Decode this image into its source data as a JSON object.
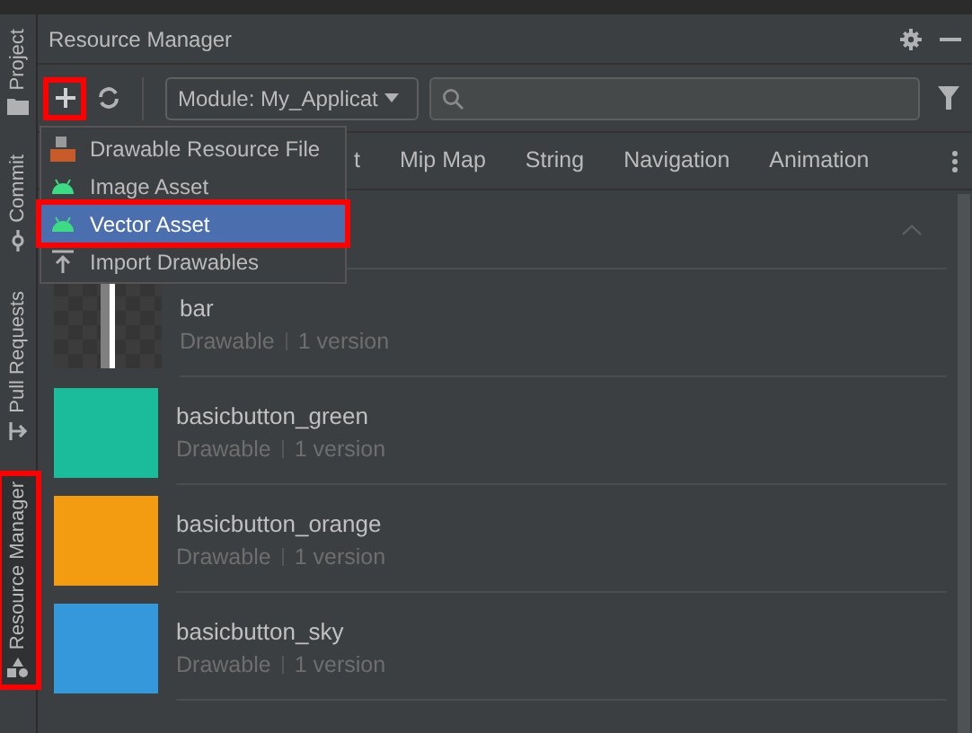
{
  "side_tabs": [
    {
      "label": "Project",
      "kind": "folder",
      "selected": false,
      "highlighted": false
    },
    {
      "label": "Commit",
      "kind": "commit",
      "selected": false,
      "highlighted": false
    },
    {
      "label": "Pull Requests",
      "kind": "pull",
      "selected": false,
      "highlighted": false
    },
    {
      "label": "Resource Manager",
      "kind": "shapes",
      "selected": true,
      "highlighted": true
    }
  ],
  "panel": {
    "title": "Resource Manager"
  },
  "toolbar": {
    "add_highlighted": true,
    "module": "Module: My_Applicat"
  },
  "tabs": [
    "t",
    "Mip Map",
    "String",
    "Navigation",
    "Animation"
  ],
  "menu": [
    {
      "label": "Drawable Resource File",
      "kind": "file",
      "selected": false,
      "highlighted": false
    },
    {
      "label": "Image Asset",
      "kind": "android",
      "selected": false,
      "highlighted": false
    },
    {
      "label": "Vector Asset",
      "kind": "android",
      "selected": true,
      "highlighted": true
    },
    {
      "label": "Import Drawables",
      "kind": "import",
      "selected": false,
      "highlighted": false
    }
  ],
  "resources": [
    {
      "name": "bar",
      "type": "Drawable",
      "versions": "1 version",
      "kind": "pattern",
      "color": "#808080"
    },
    {
      "name": "basicbutton_green",
      "type": "Drawable",
      "versions": "1 version",
      "kind": "solid",
      "color": "#1abc9c"
    },
    {
      "name": "basicbutton_orange",
      "type": "Drawable",
      "versions": "1 version",
      "kind": "solid",
      "color": "#f39c12"
    },
    {
      "name": "basicbutton_sky",
      "type": "Drawable",
      "versions": "1 version",
      "kind": "solid",
      "color": "#3498db"
    }
  ]
}
